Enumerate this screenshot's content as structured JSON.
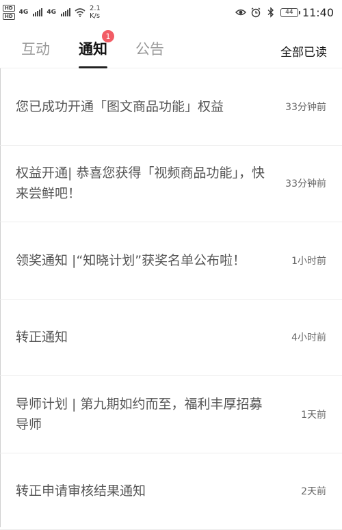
{
  "status_bar": {
    "hd1": "HD",
    "hd2": "HD",
    "net1": "4G",
    "net2": "4G",
    "speed_value": "2.1",
    "speed_unit": "K/s",
    "battery": "44",
    "time": "11:40"
  },
  "tabs": [
    {
      "label": "互动",
      "active": false
    },
    {
      "label": "通知",
      "active": true,
      "badge": "1"
    },
    {
      "label": "公告",
      "active": false
    }
  ],
  "mark_all_read": "全部已读",
  "notifications": [
    {
      "title": "您已成功开通「图文商品功能」权益",
      "time": "33分钟前"
    },
    {
      "title": "权益开通| 恭喜您获得「视频商品功能」，快来尝鲜吧！",
      "time": "33分钟前"
    },
    {
      "title": "领奖通知 |“知晓计划”获奖名单公布啦！",
      "time": "1小时前"
    },
    {
      "title": "转正通知",
      "time": "4小时前"
    },
    {
      "title": "导师计划 | 第九期如约而至，福利丰厚招募导师",
      "time": "1天前"
    },
    {
      "title": "转正申请审核结果通知",
      "time": "2天前"
    }
  ],
  "colors": {
    "badge": "#f25c65",
    "active_tab": "#111111",
    "inactive_tab": "#999999"
  }
}
